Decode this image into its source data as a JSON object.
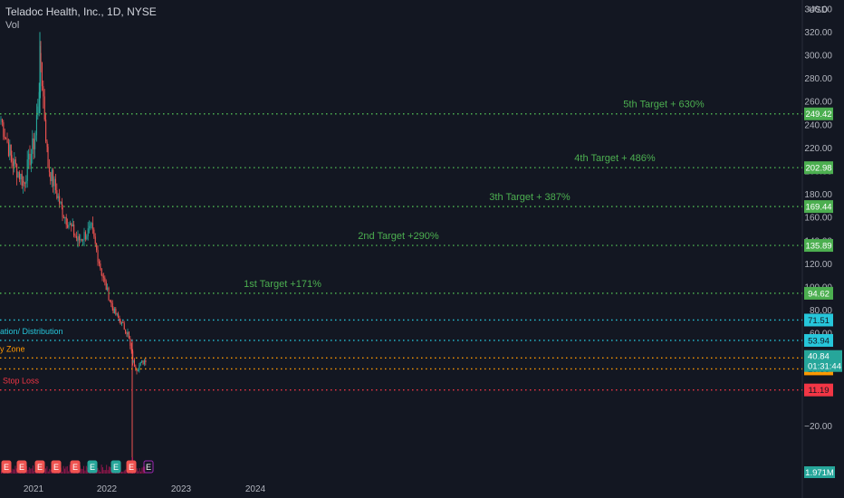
{
  "header": {
    "symbol_title": "Teladoc Health, Inc., 1D, NYSE",
    "volume_label": "Vol",
    "currency": "USD"
  },
  "colors": {
    "background": "#131722",
    "up": "#26a69a",
    "down": "#ef5350",
    "target_green": "#4caf50",
    "cyan": "#26c6da",
    "orange": "#ff9800",
    "red": "#f23645",
    "volume": "#c2185b",
    "axis_text": "#b2b5be"
  },
  "chart_data": {
    "type": "candlestick",
    "title": "Teladoc Health, Inc., 1D, NYSE",
    "ylabel": "USD",
    "y_ticks": [
      340,
      320,
      300,
      280,
      260,
      240,
      220,
      200,
      180,
      160,
      140,
      120,
      100,
      80,
      60,
      -20
    ],
    "x_ticks": [
      "2021",
      "2022",
      "2023",
      "2024"
    ],
    "ylim": [
      -30,
      345
    ],
    "grid": false,
    "price_series": {
      "x": [
        "2020-07",
        "2020-09",
        "2020-11",
        "2021-01",
        "2021-02",
        "2021-03",
        "2021-05",
        "2021-07",
        "2021-09",
        "2021-11",
        "2022-01",
        "2022-02",
        "2022-03",
        "2022-04",
        "2022-05",
        "2022-06"
      ],
      "close": [
        245,
        210,
        190,
        230,
        295,
        205,
        165,
        140,
        150,
        110,
        80,
        70,
        60,
        35,
        30,
        38
      ]
    },
    "horizontal_levels": [
      {
        "label": "5th Target + 630%",
        "value": 249.42,
        "value_label": "249.42",
        "color": "#4caf50"
      },
      {
        "label": "4th Target + 486%",
        "value": 202.98,
        "value_label": "202.98",
        "color": "#4caf50"
      },
      {
        "label": "3th Target + 387%",
        "value": 169.44,
        "value_label": "169.44",
        "color": "#4caf50"
      },
      {
        "label": "2nd Target +290%",
        "value": 135.89,
        "value_label": "135.89",
        "color": "#4caf50"
      },
      {
        "label": "1st Target +171%",
        "value": 94.62,
        "value_label": "94.62",
        "color": "#4caf50"
      },
      {
        "label": "",
        "value": 71.51,
        "value_label": "71.51",
        "color": "#26c6da"
      },
      {
        "label": "ation/ Distribution",
        "value": 53.94,
        "value_label": "53.94",
        "color": "#26c6da"
      },
      {
        "label": "y Zone",
        "value": 38.8,
        "value_label": "38.80",
        "color": "#ff9800"
      },
      {
        "label": "",
        "value": 29.36,
        "value_label": "29.36",
        "color": "#ff9800"
      },
      {
        "label": "Stop Loss",
        "value": 11.19,
        "value_label": "11.19",
        "color": "#f23645"
      }
    ],
    "current_price": {
      "value": 40.84,
      "value_label": "40.84",
      "countdown": "01:31:44"
    },
    "volume_label": "1.971M"
  }
}
